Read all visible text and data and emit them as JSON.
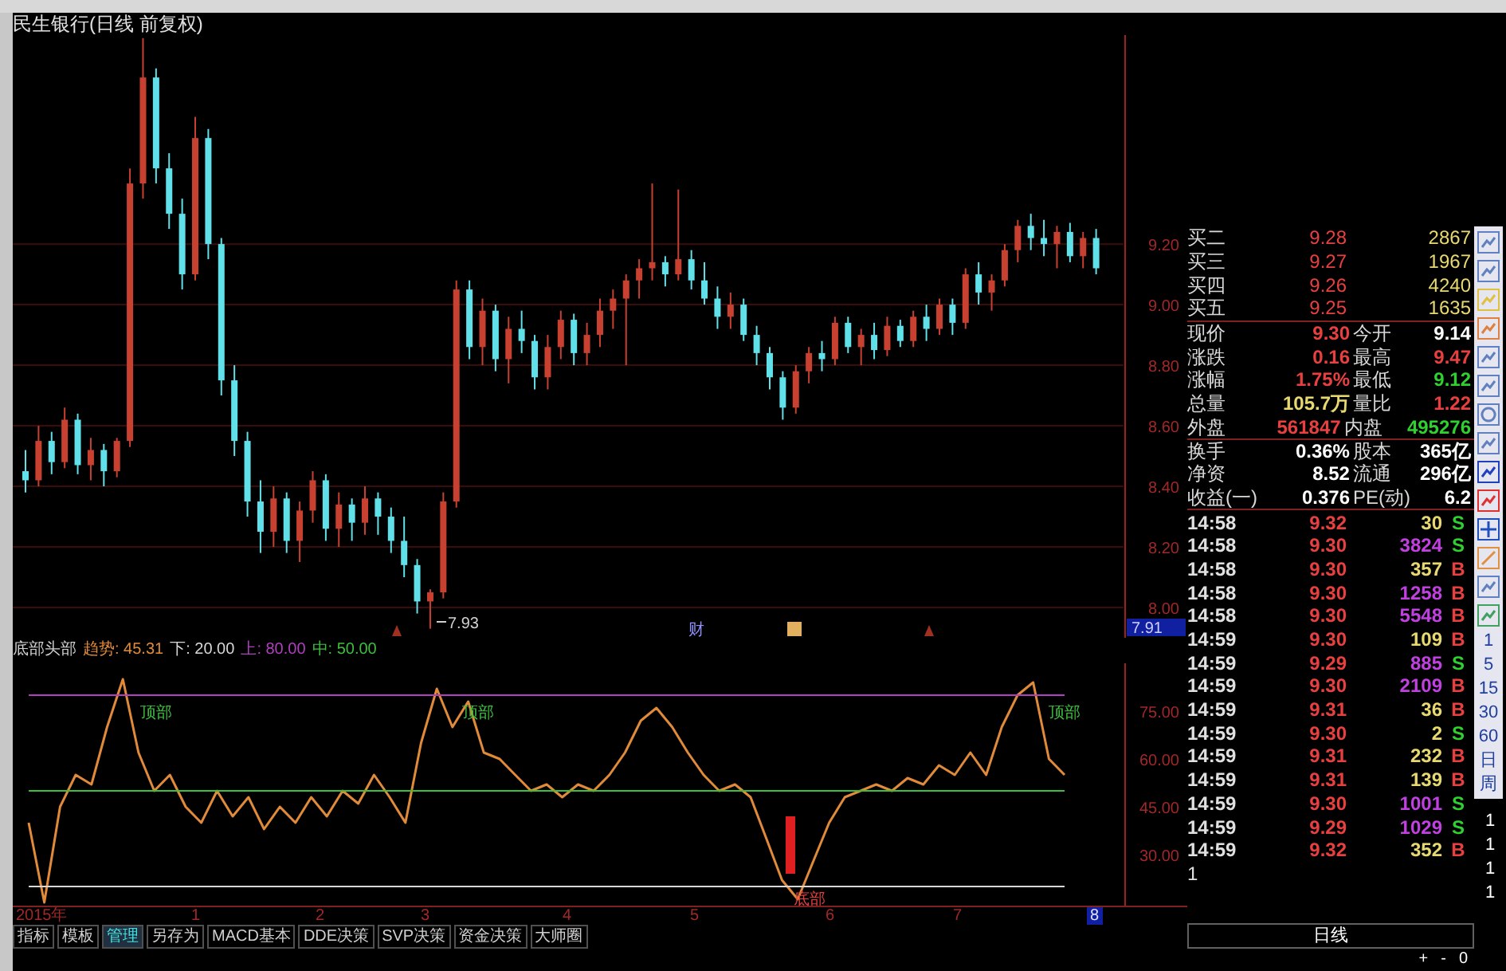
{
  "chart_title": "民生银行(日线 前复权)",
  "price_chart": {
    "chart_data": {
      "type": "candlestick",
      "ylim": [
        7.9,
        9.89
      ],
      "yticks": [
        {
          "value": 9.2,
          "label": "9.20"
        },
        {
          "value": 9.0,
          "label": "9.00"
        },
        {
          "value": 8.8,
          "label": "8.80"
        },
        {
          "value": 8.6,
          "label": "8.60"
        },
        {
          "value": 8.4,
          "label": "8.40"
        },
        {
          "value": 8.2,
          "label": "8.20"
        },
        {
          "value": 8.0,
          "label": "8.00"
        }
      ],
      "grid": true,
      "ohlc": [
        [
          8.45,
          8.52,
          8.38,
          8.42
        ],
        [
          8.42,
          8.6,
          8.4,
          8.55
        ],
        [
          8.55,
          8.58,
          8.44,
          8.48
        ],
        [
          8.48,
          8.66,
          8.46,
          8.62
        ],
        [
          8.62,
          8.64,
          8.44,
          8.47
        ],
        [
          8.47,
          8.56,
          8.42,
          8.52
        ],
        [
          8.52,
          8.54,
          8.4,
          8.45
        ],
        [
          8.45,
          8.56,
          8.43,
          8.55
        ],
        [
          8.55,
          9.45,
          8.53,
          9.4
        ],
        [
          9.4,
          9.88,
          9.35,
          9.75
        ],
        [
          9.75,
          9.78,
          9.4,
          9.45
        ],
        [
          9.45,
          9.5,
          9.25,
          9.3
        ],
        [
          9.3,
          9.35,
          9.05,
          9.1
        ],
        [
          9.1,
          9.62,
          9.08,
          9.55
        ],
        [
          9.55,
          9.58,
          9.15,
          9.2
        ],
        [
          9.2,
          9.22,
          8.7,
          8.75
        ],
        [
          8.75,
          8.8,
          8.5,
          8.55
        ],
        [
          8.55,
          8.58,
          8.3,
          8.35
        ],
        [
          8.35,
          8.42,
          8.18,
          8.25
        ],
        [
          8.25,
          8.4,
          8.2,
          8.36
        ],
        [
          8.36,
          8.38,
          8.18,
          8.22
        ],
        [
          8.22,
          8.35,
          8.15,
          8.32
        ],
        [
          8.32,
          8.45,
          8.28,
          8.42
        ],
        [
          8.42,
          8.44,
          8.22,
          8.26
        ],
        [
          8.26,
          8.38,
          8.2,
          8.34
        ],
        [
          8.34,
          8.36,
          8.22,
          8.28
        ],
        [
          8.28,
          8.4,
          8.24,
          8.36
        ],
        [
          8.36,
          8.38,
          8.24,
          8.3
        ],
        [
          8.3,
          8.33,
          8.18,
          8.22
        ],
        [
          8.22,
          8.3,
          8.1,
          8.14
        ],
        [
          8.14,
          8.16,
          7.98,
          8.02
        ],
        [
          8.02,
          8.06,
          7.93,
          8.05
        ],
        [
          8.05,
          8.38,
          8.03,
          8.35
        ],
        [
          8.35,
          9.08,
          8.33,
          9.05
        ],
        [
          9.05,
          9.08,
          8.82,
          8.86
        ],
        [
          8.86,
          9.02,
          8.8,
          8.98
        ],
        [
          8.98,
          9.0,
          8.78,
          8.82
        ],
        [
          8.82,
          8.96,
          8.74,
          8.92
        ],
        [
          8.92,
          8.98,
          8.84,
          8.88
        ],
        [
          8.88,
          8.9,
          8.72,
          8.76
        ],
        [
          8.76,
          8.9,
          8.72,
          8.86
        ],
        [
          8.86,
          8.98,
          8.82,
          8.95
        ],
        [
          8.95,
          8.97,
          8.8,
          8.84
        ],
        [
          8.84,
          8.94,
          8.8,
          8.9
        ],
        [
          8.9,
          9.02,
          8.86,
          8.98
        ],
        [
          8.98,
          9.05,
          8.92,
          9.02
        ],
        [
          9.02,
          9.1,
          8.8,
          9.08
        ],
        [
          9.08,
          9.15,
          9.02,
          9.12
        ],
        [
          9.12,
          9.4,
          9.08,
          9.14
        ],
        [
          9.14,
          9.16,
          9.06,
          9.1
        ],
        [
          9.1,
          9.38,
          9.08,
          9.15
        ],
        [
          9.15,
          9.18,
          9.05,
          9.08
        ],
        [
          9.08,
          9.14,
          9.0,
          9.02
        ],
        [
          9.02,
          9.06,
          8.92,
          8.96
        ],
        [
          8.96,
          9.04,
          8.92,
          9.0
        ],
        [
          9.0,
          9.02,
          8.88,
          8.9
        ],
        [
          8.9,
          8.93,
          8.8,
          8.84
        ],
        [
          8.84,
          8.86,
          8.72,
          8.76
        ],
        [
          8.76,
          8.78,
          8.62,
          8.66
        ],
        [
          8.66,
          8.8,
          8.64,
          8.78
        ],
        [
          8.78,
          8.86,
          8.74,
          8.84
        ],
        [
          8.84,
          8.88,
          8.78,
          8.82
        ],
        [
          8.82,
          8.96,
          8.8,
          8.94
        ],
        [
          8.94,
          8.96,
          8.84,
          8.86
        ],
        [
          8.86,
          8.92,
          8.8,
          8.9
        ],
        [
          8.9,
          8.94,
          8.82,
          8.85
        ],
        [
          8.85,
          8.96,
          8.83,
          8.93
        ],
        [
          8.93,
          8.95,
          8.86,
          8.88
        ],
        [
          8.88,
          8.98,
          8.86,
          8.96
        ],
        [
          8.96,
          9.0,
          8.88,
          8.92
        ],
        [
          8.92,
          9.02,
          8.9,
          9.0
        ],
        [
          9.0,
          9.02,
          8.9,
          8.94
        ],
        [
          8.94,
          9.12,
          8.92,
          9.1
        ],
        [
          9.1,
          9.14,
          9.0,
          9.04
        ],
        [
          9.04,
          9.1,
          8.98,
          9.08
        ],
        [
          9.08,
          9.2,
          9.06,
          9.18
        ],
        [
          9.18,
          9.28,
          9.14,
          9.26
        ],
        [
          9.26,
          9.3,
          9.18,
          9.22
        ],
        [
          9.22,
          9.28,
          9.16,
          9.2
        ],
        [
          9.2,
          9.26,
          9.12,
          9.24
        ],
        [
          9.24,
          9.27,
          9.14,
          9.16
        ],
        [
          9.16,
          9.24,
          9.12,
          9.22
        ],
        [
          9.22,
          9.25,
          9.1,
          9.12
        ]
      ]
    },
    "current_price_tag": "7.91",
    "low_label": "7.93",
    "event_marker": "财"
  },
  "indicator": {
    "name": "底部头部",
    "label_separator": ":",
    "readings": [
      "45.31",
      "20.00",
      "80.00",
      "50.00"
    ],
    "top_labels": [
      "顶部",
      "顶部",
      "顶部"
    ],
    "bottom_label": "底部",
    "chart_data": {
      "type": "line",
      "ylim": [
        14,
        90
      ],
      "yticks": [
        {
          "value": 75,
          "label": "75.00"
        },
        {
          "value": 60,
          "label": "60.00"
        },
        {
          "value": 45,
          "label": "45.00"
        },
        {
          "value": 30,
          "label": "30.00"
        }
      ],
      "series": [
        {
          "name": "趋势",
          "color": "#e08a3a",
          "values": [
            40,
            15,
            45,
            55,
            52,
            70,
            85,
            62,
            50,
            55,
            45,
            40,
            50,
            42,
            48,
            38,
            45,
            40,
            48,
            42,
            50,
            46,
            55,
            48,
            40,
            65,
            82,
            70,
            78,
            62,
            60,
            55,
            50,
            52,
            48,
            52,
            50,
            55,
            62,
            72,
            76,
            70,
            62,
            55,
            50,
            52,
            48,
            35,
            22,
            16,
            28,
            40,
            48,
            50,
            52,
            50,
            54,
            52,
            58,
            55,
            62,
            55,
            70,
            80,
            84,
            60,
            55
          ]
        },
        {
          "name": "下",
          "color": "#d8d8d8",
          "values": [
            20,
            20,
            20,
            20,
            20,
            20,
            20,
            20,
            20,
            20,
            20,
            20,
            20,
            20,
            20,
            20,
            20,
            20,
            20,
            20,
            20,
            20,
            20,
            20,
            20,
            20,
            20,
            20,
            20,
            20,
            20,
            20,
            20,
            20,
            20,
            20,
            20,
            20,
            20,
            20,
            20,
            20,
            20,
            20,
            20,
            20,
            20,
            20,
            20,
            20,
            20,
            20,
            20,
            20,
            20,
            20,
            20,
            20,
            20,
            20,
            20,
            20,
            20,
            20,
            20,
            20,
            20
          ]
        },
        {
          "name": "上",
          "color": "#b040c0",
          "values": [
            80,
            80,
            80,
            80,
            80,
            80,
            80,
            80,
            80,
            80,
            80,
            80,
            80,
            80,
            80,
            80,
            80,
            80,
            80,
            80,
            80,
            80,
            80,
            80,
            80,
            80,
            80,
            80,
            80,
            80,
            80,
            80,
            80,
            80,
            80,
            80,
            80,
            80,
            80,
            80,
            80,
            80,
            80,
            80,
            80,
            80,
            80,
            80,
            80,
            80,
            80,
            80,
            80,
            80,
            80,
            80,
            80,
            80,
            80,
            80,
            80,
            80,
            80,
            80,
            80,
            80,
            80
          ]
        },
        {
          "name": "中",
          "color": "#3cc03c",
          "values": [
            50,
            50,
            50,
            50,
            50,
            50,
            50,
            50,
            50,
            50,
            50,
            50,
            50,
            50,
            50,
            50,
            50,
            50,
            50,
            50,
            50,
            50,
            50,
            50,
            50,
            50,
            50,
            50,
            50,
            50,
            50,
            50,
            50,
            50,
            50,
            50,
            50,
            50,
            50,
            50,
            50,
            50,
            50,
            50,
            50,
            50,
            50,
            50,
            50,
            50,
            50,
            50,
            50,
            50,
            50,
            50,
            50,
            50,
            50,
            50,
            50,
            50,
            50,
            50,
            50,
            50,
            50
          ]
        }
      ]
    }
  },
  "date_axis": [
    "2015年",
    "1",
    "2",
    "3",
    "4",
    "5",
    "6",
    "7",
    "8"
  ],
  "period_label": "日线",
  "zoom_controls": [
    "+",
    "-",
    "0"
  ],
  "tabs": [
    {
      "label": "指标",
      "selected": false
    },
    {
      "label": "模板",
      "selected": false
    },
    {
      "label": "管理",
      "selected": true
    },
    {
      "label": "另存为",
      "selected": false
    },
    {
      "label": "MACD基本",
      "selected": false
    },
    {
      "label": "DDE决策",
      "selected": false
    },
    {
      "label": "SVP决策",
      "selected": false
    },
    {
      "label": "资金决策",
      "selected": false
    },
    {
      "label": "大师圈",
      "selected": false
    }
  ],
  "order_book": [
    {
      "label": "买二",
      "price": "9.28",
      "volume": "2867"
    },
    {
      "label": "买三",
      "price": "9.27",
      "volume": "1967"
    },
    {
      "label": "买四",
      "price": "9.26",
      "volume": "4240"
    },
    {
      "label": "买五",
      "price": "9.25",
      "volume": "1635"
    }
  ],
  "quote": [
    {
      "cells": [
        {
          "label": "现价",
          "value": "9.30",
          "color": "#e84040"
        },
        {
          "label": "今开",
          "value": "9.14",
          "color": "#ffffff"
        }
      ]
    },
    {
      "cells": [
        {
          "label": "涨跌",
          "value": "0.16",
          "color": "#e84040"
        },
        {
          "label": "最高",
          "value": "9.47",
          "color": "#e84040"
        }
      ]
    },
    {
      "cells": [
        {
          "label": "涨幅",
          "value": "1.75%",
          "color": "#e84040"
        },
        {
          "label": "最低",
          "value": "9.12",
          "color": "#30d030"
        }
      ]
    },
    {
      "cells": [
        {
          "label": "总量",
          "value": "105.7万",
          "color": "#e8d870"
        },
        {
          "label": "量比",
          "value": "1.22",
          "color": "#e84040"
        }
      ]
    },
    {
      "cells": [
        {
          "label": "外盘",
          "value": "561847",
          "color": "#e84040"
        },
        {
          "label": "内盘",
          "value": "495276",
          "color": "#30d030"
        }
      ]
    },
    {
      "cells": [
        {
          "label": "换手",
          "value": "0.36%",
          "color": "#ffffff"
        },
        {
          "label": "股本",
          "value": "365亿",
          "color": "#ffffff"
        }
      ]
    },
    {
      "cells": [
        {
          "label": "净资",
          "value": "8.52",
          "color": "#ffffff"
        },
        {
          "label": "流通",
          "value": "296亿",
          "color": "#ffffff"
        }
      ]
    },
    {
      "cells": [
        {
          "label": "收益(一)",
          "value": "0.376",
          "color": "#ffffff"
        },
        {
          "label": "PE(动)",
          "value": "6.2",
          "color": "#ffffff"
        }
      ]
    }
  ],
  "ticks": [
    {
      "time": "14:58",
      "price": "9.32",
      "volume": "30",
      "color": "#e8d870",
      "side": "S"
    },
    {
      "time": "14:58",
      "price": "9.30",
      "volume": "3824",
      "color": "#c040e0",
      "side": "S"
    },
    {
      "time": "14:58",
      "price": "9.30",
      "volume": "357",
      "color": "#e8d870",
      "side": "B"
    },
    {
      "time": "14:58",
      "price": "9.30",
      "volume": "1258",
      "color": "#c040e0",
      "side": "B"
    },
    {
      "time": "14:58",
      "price": "9.30",
      "volume": "5548",
      "color": "#c040e0",
      "side": "B"
    },
    {
      "time": "14:59",
      "price": "9.30",
      "volume": "109",
      "color": "#e8d870",
      "side": "B"
    },
    {
      "time": "14:59",
      "price": "9.29",
      "volume": "885",
      "color": "#c040e0",
      "side": "S"
    },
    {
      "time": "14:59",
      "price": "9.30",
      "volume": "2109",
      "color": "#c040e0",
      "side": "B"
    },
    {
      "time": "14:59",
      "price": "9.31",
      "volume": "36",
      "color": "#e8d870",
      "side": "B"
    },
    {
      "time": "14:59",
      "price": "9.30",
      "volume": "2",
      "color": "#e8d870",
      "side": "S"
    },
    {
      "time": "14:59",
      "price": "9.31",
      "volume": "232",
      "color": "#e8d870",
      "side": "B"
    },
    {
      "time": "14:59",
      "price": "9.31",
      "volume": "139",
      "color": "#e8d870",
      "side": "B"
    },
    {
      "time": "14:59",
      "price": "9.30",
      "volume": "1001",
      "color": "#c040e0",
      "side": "S"
    },
    {
      "time": "14:59",
      "price": "9.29",
      "volume": "1029",
      "color": "#c040e0",
      "side": "S"
    },
    {
      "time": "14:59",
      "price": "9.32",
      "volume": "352",
      "color": "#e8d870",
      "side": "B"
    }
  ],
  "ticks_footer": "1",
  "period_buttons": [
    "1",
    "5",
    "15",
    "30",
    "60",
    "日",
    "周"
  ],
  "edge_marks": [
    "1",
    "1",
    "1",
    "1"
  ]
}
